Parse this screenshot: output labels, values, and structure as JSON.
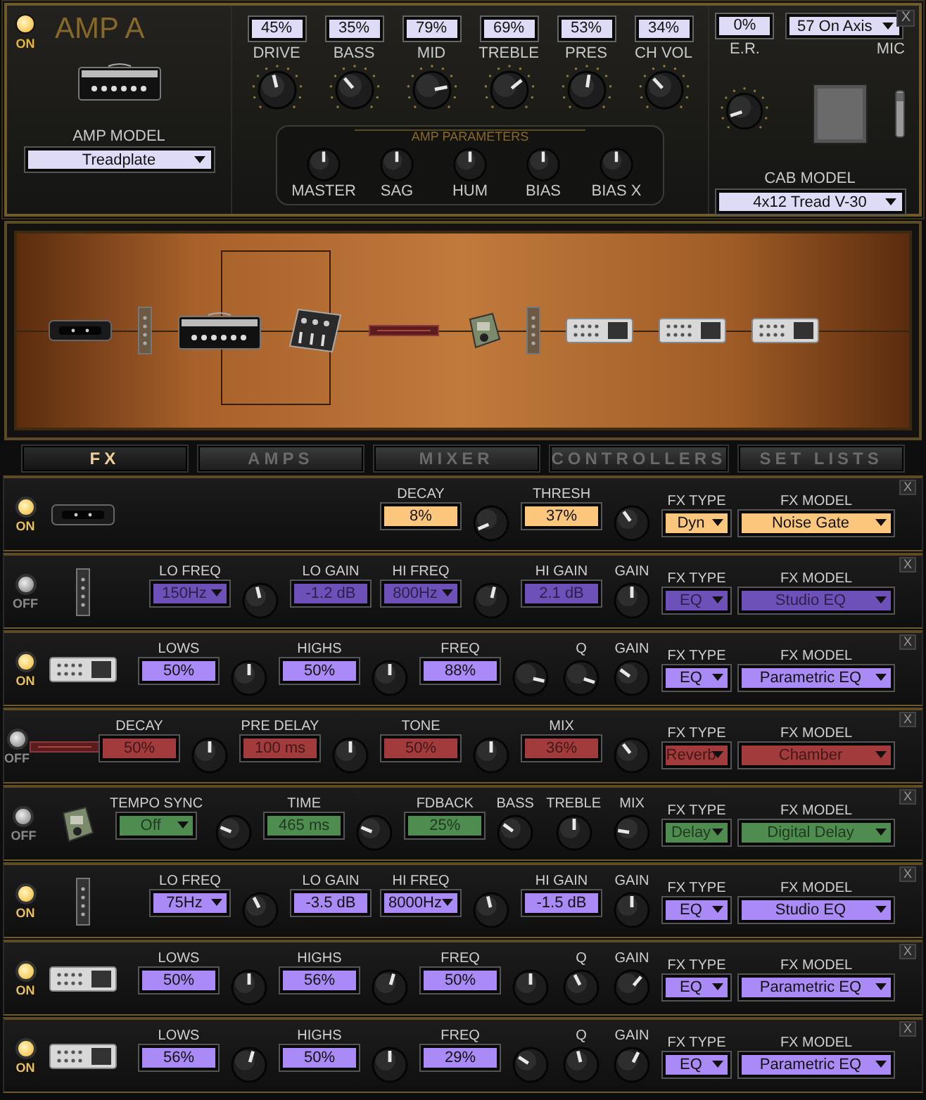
{
  "amp": {
    "power": {
      "on": true,
      "label": "ON"
    },
    "title": "AMP A",
    "close": "X",
    "amp_model": {
      "label": "AMP MODEL",
      "value": "Treadplate"
    },
    "tone_knobs": [
      {
        "label": "DRIVE",
        "value": "45%",
        "level": 0.45
      },
      {
        "label": "BASS",
        "value": "35%",
        "level": 0.35
      },
      {
        "label": "MID",
        "value": "79%",
        "level": 0.79
      },
      {
        "label": "TREBLE",
        "value": "69%",
        "level": 0.69
      },
      {
        "label": "PRES",
        "value": "53%",
        "level": 0.53
      },
      {
        "label": "CH VOL",
        "value": "34%",
        "level": 0.34
      }
    ],
    "amp_parameters": {
      "title": "AMP PARAMETERS",
      "knobs": [
        {
          "label": "MASTER",
          "level": 0.5
        },
        {
          "label": "SAG",
          "level": 0.5
        },
        {
          "label": "HUM",
          "level": 0.5
        },
        {
          "label": "BIAS",
          "level": 0.5
        },
        {
          "label": "BIAS X",
          "level": 0.5
        }
      ]
    },
    "er": {
      "label": "E.R.",
      "value": "0%",
      "level": 0.1
    },
    "mic": {
      "label": "MIC",
      "value": "57 On Axis"
    },
    "cab_model": {
      "label": "CAB MODEL",
      "value": "4x12 Tread V-30"
    }
  },
  "chain": [
    {
      "kind": "gate"
    },
    {
      "kind": "eq"
    },
    {
      "kind": "amp"
    },
    {
      "kind": "mixer"
    },
    {
      "kind": "reverb"
    },
    {
      "kind": "delay"
    },
    {
      "kind": "eq"
    },
    {
      "kind": "parametric"
    },
    {
      "kind": "parametric"
    },
    {
      "kind": "parametric"
    }
  ],
  "tabs": [
    {
      "label": "FX",
      "selected": true
    },
    {
      "label": "AMPS",
      "selected": false
    },
    {
      "label": "MIXER",
      "selected": false
    },
    {
      "label": "CONTROLLERS",
      "selected": false
    },
    {
      "label": "SET LISTS",
      "selected": false
    }
  ],
  "fx_rows": [
    {
      "on": true,
      "power_label": "ON",
      "kind": "gate",
      "color": "#fcc77c",
      "controls": [
        {
          "kind": "readout",
          "label": "DECAY",
          "value": "8%"
        },
        {
          "kind": "knob",
          "level": 0.08
        },
        {
          "kind": "readout",
          "label": "THRESH",
          "value": "37%"
        },
        {
          "kind": "knob",
          "level": 0.37
        }
      ],
      "fx_type": {
        "label": "FX TYPE",
        "value": "Dyn"
      },
      "fx_model": {
        "label": "FX MODEL",
        "value": "Noise Gate"
      },
      "close": "X"
    },
    {
      "on": false,
      "power_label": "OFF",
      "kind": "eq",
      "color": "#6d50b8",
      "controls": [
        {
          "kind": "select",
          "label": "LO FREQ",
          "value": "150Hz"
        },
        {
          "kind": "knob",
          "level": 0.45
        },
        {
          "kind": "readout",
          "label": "LO GAIN",
          "value": "-1.2 dB"
        },
        {
          "kind": "select",
          "label": "HI FREQ",
          "value": "800Hz"
        },
        {
          "kind": "knob",
          "level": 0.55
        },
        {
          "kind": "readout",
          "label": "HI GAIN",
          "value": "2.1 dB"
        },
        {
          "kind": "knob",
          "label": "GAIN",
          "level": 0.5
        }
      ],
      "fx_type": {
        "label": "FX TYPE",
        "value": "EQ"
      },
      "fx_model": {
        "label": "FX MODEL",
        "value": "Studio EQ"
      },
      "close": "X"
    },
    {
      "on": true,
      "power_label": "ON",
      "kind": "parametric",
      "color": "#a98af7",
      "controls": [
        {
          "kind": "readout",
          "label": "LOWS",
          "value": "50%"
        },
        {
          "kind": "knob",
          "level": 0.5
        },
        {
          "kind": "readout",
          "label": "HIGHS",
          "value": "50%"
        },
        {
          "kind": "knob",
          "level": 0.5
        },
        {
          "kind": "readout",
          "label": "FREQ",
          "value": "88%"
        },
        {
          "kind": "knob",
          "level": 0.88
        },
        {
          "kind": "knob",
          "label": "Q",
          "level": 0.9
        },
        {
          "kind": "knob",
          "label": "GAIN",
          "level": 0.3
        }
      ],
      "fx_type": {
        "label": "FX TYPE",
        "value": "EQ"
      },
      "fx_model": {
        "label": "FX MODEL",
        "value": "Parametric EQ"
      },
      "close": "X"
    },
    {
      "on": false,
      "power_label": "OFF",
      "kind": "reverb",
      "color": "#a23b3b",
      "controls": [
        {
          "kind": "readout",
          "label": "DECAY",
          "value": "50%"
        },
        {
          "kind": "knob",
          "level": 0.5
        },
        {
          "kind": "readout",
          "label": "PRE DELAY",
          "value": "100 ms"
        },
        {
          "kind": "knob",
          "level": 0.5
        },
        {
          "kind": "readout",
          "label": "TONE",
          "value": "50%"
        },
        {
          "kind": "knob",
          "level": 0.5
        },
        {
          "kind": "readout",
          "label": "MIX",
          "value": "36%"
        },
        {
          "kind": "knob",
          "level": 0.36
        }
      ],
      "fx_type": {
        "label": "FX TYPE",
        "value": "Reverb"
      },
      "fx_model": {
        "label": "FX MODEL",
        "value": "Chamber"
      },
      "close": "X"
    },
    {
      "on": false,
      "power_label": "OFF",
      "kind": "delay",
      "color": "#4f8c4f",
      "controls": [
        {
          "kind": "select",
          "label": "TEMPO SYNC",
          "value": "Off"
        },
        {
          "kind": "knob",
          "level": 0.25
        },
        {
          "kind": "readout",
          "label": "TIME",
          "value": "465 ms"
        },
        {
          "kind": "knob",
          "level": 0.25
        },
        {
          "kind": "readout",
          "label": "FDBACK",
          "value": "25%"
        },
        {
          "kind": "knob",
          "label": "BASS",
          "level": 0.3
        },
        {
          "kind": "knob",
          "label": "TREBLE",
          "level": 0.5
        },
        {
          "kind": "knob",
          "label": "MIX",
          "level": 0.2
        }
      ],
      "fx_type": {
        "label": "FX TYPE",
        "value": "Delay"
      },
      "fx_model": {
        "label": "FX MODEL",
        "value": "Digital Delay"
      },
      "close": "X"
    },
    {
      "on": true,
      "power_label": "ON",
      "kind": "eq",
      "color": "#a98af7",
      "controls": [
        {
          "kind": "select",
          "label": "LO FREQ",
          "value": "75Hz"
        },
        {
          "kind": "knob",
          "level": 0.4
        },
        {
          "kind": "readout",
          "label": "LO GAIN",
          "value": "-3.5 dB"
        },
        {
          "kind": "select",
          "label": "HI FREQ",
          "value": "8000Hz"
        },
        {
          "kind": "knob",
          "level": 0.45
        },
        {
          "kind": "readout",
          "label": "HI GAIN",
          "value": "-1.5 dB"
        },
        {
          "kind": "knob",
          "label": "GAIN",
          "level": 0.5
        }
      ],
      "fx_type": {
        "label": "FX TYPE",
        "value": "EQ"
      },
      "fx_model": {
        "label": "FX MODEL",
        "value": "Studio EQ"
      },
      "close": "X"
    },
    {
      "on": true,
      "power_label": "ON",
      "kind": "parametric",
      "color": "#a98af7",
      "controls": [
        {
          "kind": "readout",
          "label": "LOWS",
          "value": "50%"
        },
        {
          "kind": "knob",
          "level": 0.5
        },
        {
          "kind": "readout",
          "label": "HIGHS",
          "value": "56%"
        },
        {
          "kind": "knob",
          "level": 0.56
        },
        {
          "kind": "readout",
          "label": "FREQ",
          "value": "50%"
        },
        {
          "kind": "knob",
          "level": 0.5
        },
        {
          "kind": "knob",
          "label": "Q",
          "level": 0.4
        },
        {
          "kind": "knob",
          "label": "GAIN",
          "level": 0.65
        }
      ],
      "fx_type": {
        "label": "FX TYPE",
        "value": "EQ"
      },
      "fx_model": {
        "label": "FX MODEL",
        "value": "Parametric EQ"
      },
      "close": "X"
    },
    {
      "on": true,
      "power_label": "ON",
      "kind": "parametric",
      "color": "#a98af7",
      "controls": [
        {
          "kind": "readout",
          "label": "LOWS",
          "value": "56%"
        },
        {
          "kind": "knob",
          "level": 0.56
        },
        {
          "kind": "readout",
          "label": "HIGHS",
          "value": "50%"
        },
        {
          "kind": "knob",
          "level": 0.5
        },
        {
          "kind": "readout",
          "label": "FREQ",
          "value": "29%"
        },
        {
          "kind": "knob",
          "level": 0.29
        },
        {
          "kind": "knob",
          "label": "Q",
          "level": 0.45
        },
        {
          "kind": "knob",
          "label": "GAIN",
          "level": 0.6
        }
      ],
      "fx_type": {
        "label": "FX TYPE",
        "value": "EQ"
      },
      "fx_model": {
        "label": "FX MODEL",
        "value": "Parametric EQ"
      },
      "close": "X"
    }
  ]
}
